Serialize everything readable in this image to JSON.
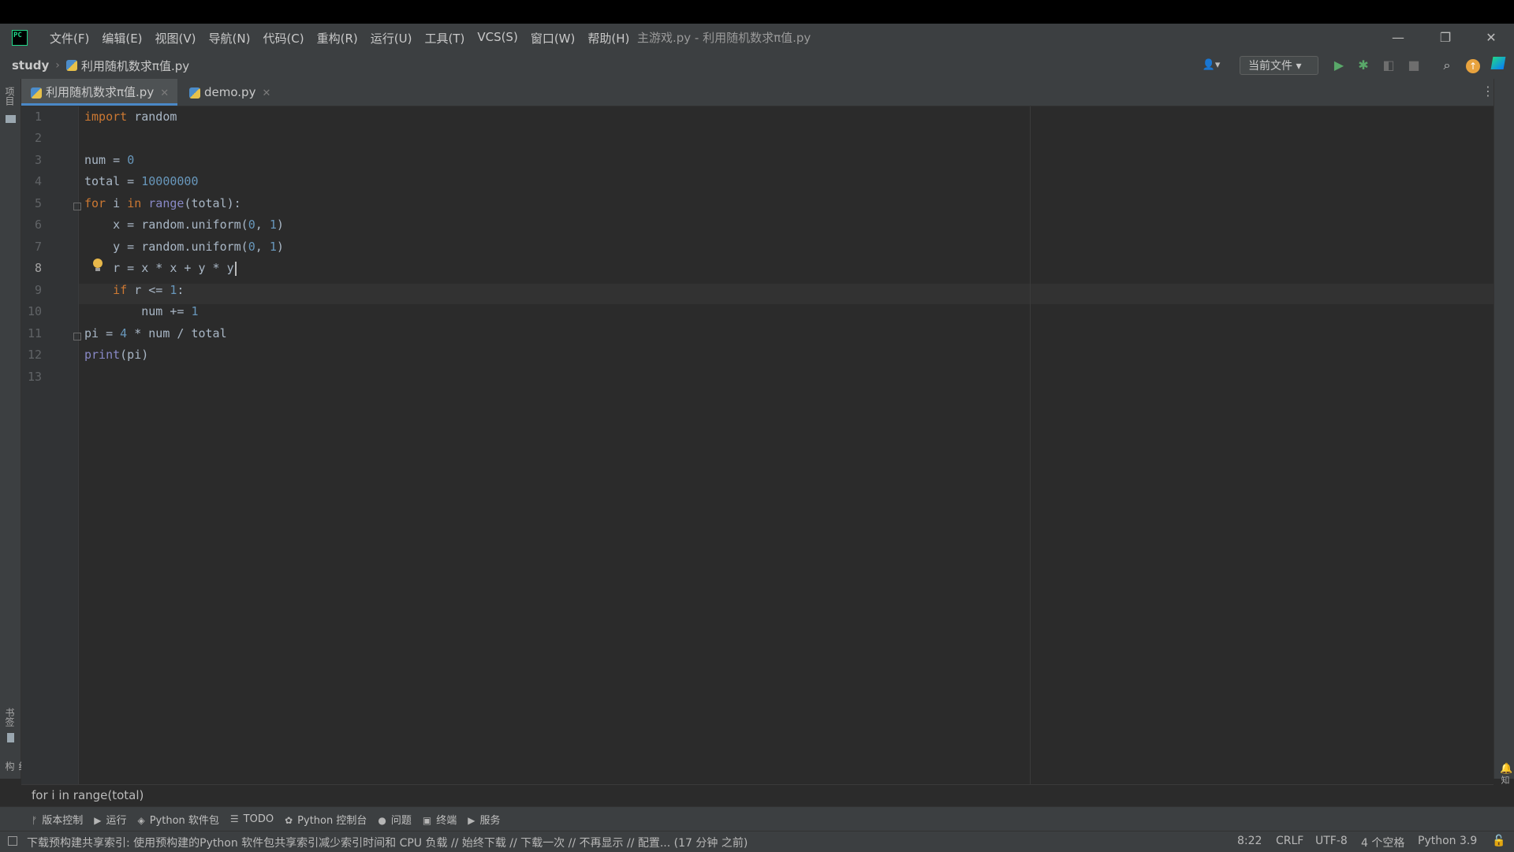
{
  "menu": [
    "文件(F)",
    "编辑(E)",
    "视图(V)",
    "导航(N)",
    "代码(C)",
    "重构(R)",
    "运行(U)",
    "工具(T)",
    "VCS(S)",
    "窗口(W)",
    "帮助(H)"
  ],
  "window": {
    "title": "主游戏.py - 利用随机数求π值.py",
    "minimize_glyph": "—",
    "restore_glyph": "❐",
    "close_glyph": "✕"
  },
  "navbar": {
    "project": "study",
    "file": "利用随机数求π值.py",
    "run_config": "当前文件 ▾",
    "user_glyph": "👤▾"
  },
  "left_strip": {
    "project": "项目",
    "bookmarks": "书签",
    "structure": "结构"
  },
  "right_strip": {
    "notifications": "通知"
  },
  "tabs": [
    {
      "label": "利用随机数求π值.py",
      "active": true
    },
    {
      "label": "demo.py",
      "active": false
    }
  ],
  "tab_close_glyph": "✕",
  "code": {
    "line_numbers": [
      "1",
      "2",
      "3",
      "4",
      "5",
      "6",
      "7",
      "8",
      "9",
      "10",
      "11",
      "12",
      "13"
    ],
    "current_line": "8"
  },
  "breadcrumb": "for i in range(total)",
  "tool_windows": [
    {
      "icon": "ᚠ",
      "label": "版本控制"
    },
    {
      "icon": "▶",
      "label": "运行"
    },
    {
      "icon": "◈",
      "label": "Python 软件包"
    },
    {
      "icon": "☰",
      "label": "TODO"
    },
    {
      "icon": "✿",
      "label": "Python 控制台"
    },
    {
      "icon": "●",
      "label": "问题"
    },
    {
      "icon": "▣",
      "label": "终端"
    },
    {
      "icon": "▶",
      "label": "服务"
    }
  ],
  "status": {
    "message": "下载预构建共享索引: 使用预构建的Python 软件包共享索引减少索引时间和 CPU 负载 // 始终下载 // 下载一次 // 不再显示 // 配置... (17 分钟 之前)",
    "position": "8:22",
    "line_ending": "CRLF",
    "encoding": "UTF-8",
    "indent": "4 个空格",
    "interpreter": "Python 3.9"
  },
  "colors": {
    "keyword": "#cc7832",
    "number": "#6897bb",
    "builtin": "#8888c6",
    "text": "#a9b7c6",
    "accent": "#4a88c7"
  }
}
